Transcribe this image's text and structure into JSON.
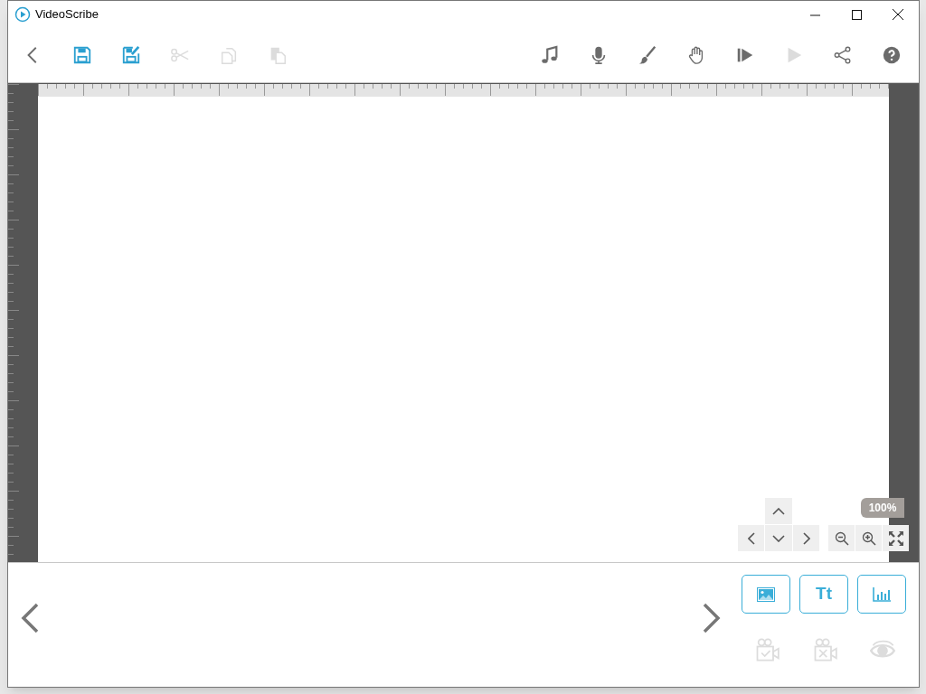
{
  "window": {
    "title": "VideoScribe"
  },
  "toolbar_left": [
    {
      "kind": "back",
      "disabled": false
    },
    {
      "kind": "save",
      "disabled": false
    },
    {
      "kind": "save-as",
      "disabled": false
    },
    {
      "kind": "cut",
      "disabled": true
    },
    {
      "kind": "copy",
      "disabled": true
    },
    {
      "kind": "paste",
      "disabled": true
    }
  ],
  "toolbar_right": [
    {
      "kind": "music",
      "disabled": false
    },
    {
      "kind": "mic",
      "disabled": false
    },
    {
      "kind": "brush",
      "disabled": false
    },
    {
      "kind": "hand",
      "disabled": false
    },
    {
      "kind": "play-from",
      "disabled": false
    },
    {
      "kind": "play",
      "disabled": true
    },
    {
      "kind": "share",
      "disabled": false
    },
    {
      "kind": "help",
      "disabled": false
    }
  ],
  "zoom": {
    "label": "100%"
  },
  "add_buttons": [
    {
      "kind": "image"
    },
    {
      "kind": "text",
      "label": "Tt"
    },
    {
      "kind": "chart"
    }
  ],
  "element_actions": [
    {
      "kind": "camera-check",
      "disabled": true
    },
    {
      "kind": "camera-x",
      "disabled": true
    },
    {
      "kind": "eye",
      "disabled": true
    }
  ]
}
